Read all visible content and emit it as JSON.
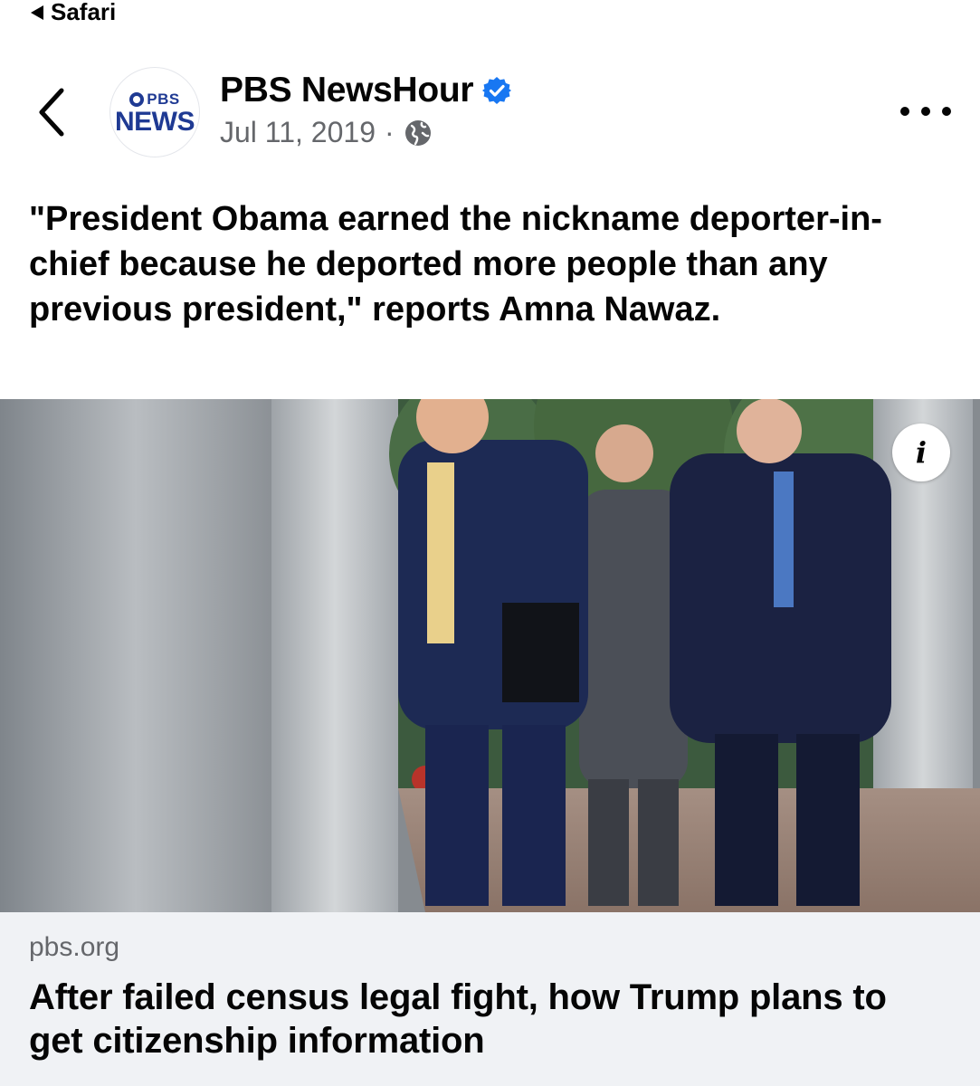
{
  "status_bar": {
    "back_app_label": "Safari"
  },
  "post": {
    "page_name": "PBS NewsHour",
    "verified": true,
    "date": "Jul 11, 2019",
    "meta_separator": "·",
    "privacy_icon": "globe-icon",
    "avatar": {
      "line1": "PBS",
      "line2": "NEWS"
    },
    "caption": "\"President Obama earned the nickname deporter-in-chief because he deported more people than any previous president,\" reports Amna Nawaz."
  },
  "link_preview": {
    "image_description_icon": "i",
    "domain": "pbs.org",
    "title": "After failed census legal fight, how Trump plans to get citizenship information"
  },
  "colors": {
    "brand_blue": "#1f3a93",
    "verified_blue": "#1877f2",
    "meta_gray": "#65676b",
    "link_footer_bg": "#f0f2f5"
  }
}
